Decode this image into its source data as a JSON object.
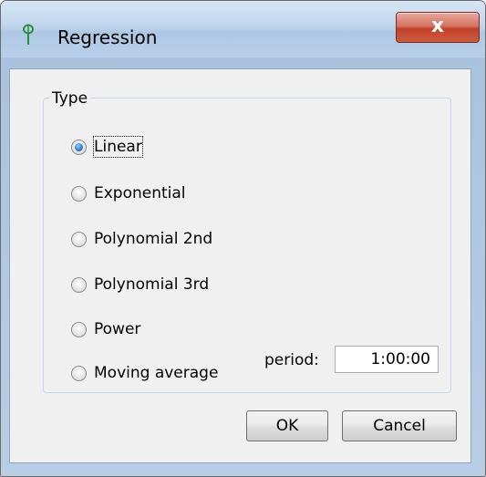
{
  "window": {
    "title": "Regression",
    "close_label": "x",
    "accent_color": "#2c7fd0"
  },
  "type_group": {
    "label": "Type",
    "options": [
      {
        "label": "Linear",
        "checked": true
      },
      {
        "label": "Exponential",
        "checked": false
      },
      {
        "label": "Polynomial 2nd",
        "checked": false
      },
      {
        "label": "Polynomial 3rd",
        "checked": false
      },
      {
        "label": "Power",
        "checked": false
      },
      {
        "label": "Moving average",
        "checked": false
      }
    ],
    "period_label": "period:",
    "period_value": "1:00:00"
  },
  "buttons": {
    "ok_label": "OK",
    "cancel_label": "Cancel"
  }
}
